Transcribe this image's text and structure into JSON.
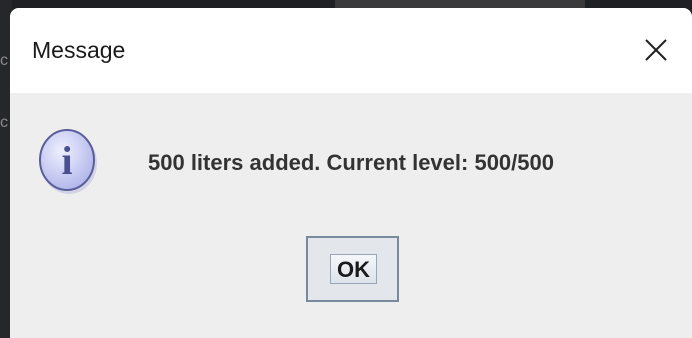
{
  "background": {
    "side_chars": [
      "c",
      "c"
    ]
  },
  "dialog": {
    "title": "Message",
    "close_icon": "close-icon",
    "info_icon": "info-icon",
    "info_glyph": "i",
    "message": "500 liters added. Current level: 500/500",
    "ok_label": "OK"
  },
  "colors": {
    "dialog_bg": "#eeeeee",
    "titlebar_bg": "#ffffff",
    "icon_fill": "#c8cbf0",
    "icon_stroke": "#5a5e9a"
  }
}
